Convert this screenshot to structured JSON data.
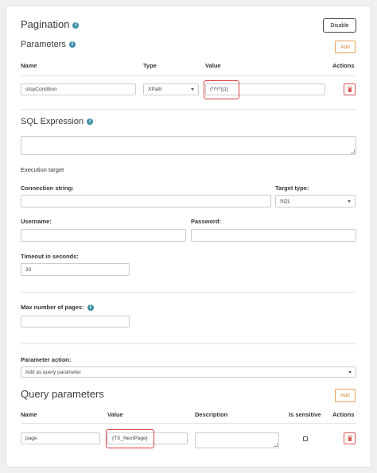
{
  "pagination": {
    "title": "Pagination",
    "disable_label": "Disable"
  },
  "parameters": {
    "title": "Parameters",
    "add_label": "Add",
    "columns": {
      "name": "Name",
      "type": "Type",
      "value": "Value",
      "actions": "Actions"
    },
    "row": {
      "name": "stopCondition",
      "type": "XPath",
      "value": "(*/*/*)[1]"
    }
  },
  "sql": {
    "title": "SQL Expression",
    "expression": "",
    "execution_target_label": "Execution target",
    "connection_string_label": "Connection string:",
    "connection_string": "",
    "target_type_label": "Target type:",
    "target_type": "SQL",
    "username_label": "Username:",
    "username": "",
    "password_label": "Password:",
    "password": "",
    "timeout_label": "Timeout in seconds:",
    "timeout": "30"
  },
  "max_pages": {
    "label": "Max number of pages:",
    "value": ""
  },
  "parameter_action": {
    "label": "Parameter action:",
    "value": "Add as query parameter"
  },
  "query_parameters": {
    "title": "Query parameters",
    "add_label": "Add",
    "columns": {
      "name": "Name",
      "value": "Value",
      "description": "Description",
      "is_sensitive": "Is sensitive",
      "actions": "Actions"
    },
    "row": {
      "name": "page",
      "value": "{TX_NextPage}",
      "description": "",
      "is_sensitive": false
    }
  },
  "icons": {
    "info": "info-icon",
    "delete": "trash-icon",
    "dropdown": "chevron-down-icon"
  },
  "colors": {
    "accent_orange": "#d9812e",
    "danger": "#d9534f",
    "info": "#3e8fa6",
    "highlight": "#d9403a"
  }
}
